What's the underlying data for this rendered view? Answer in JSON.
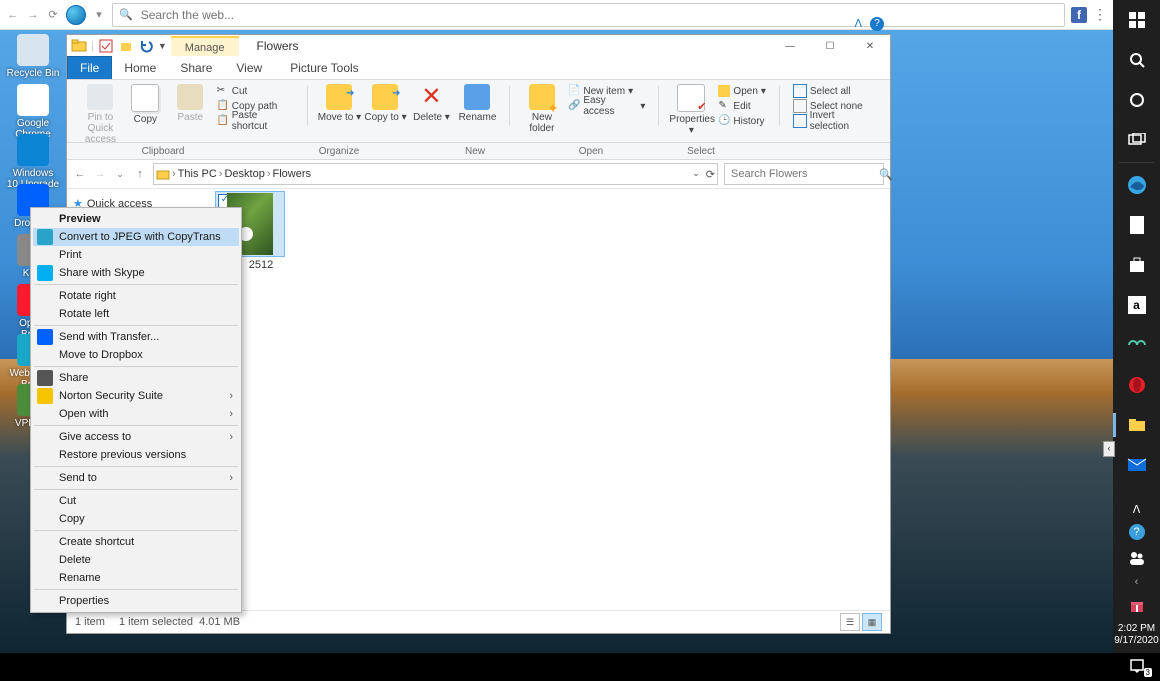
{
  "browser": {
    "search_placeholder": "Search the web..."
  },
  "desktop_icons": [
    {
      "label": "Recycle Bin"
    },
    {
      "label": "Google Chrome"
    },
    {
      "label": "Windows 10 Upgrade A..."
    },
    {
      "label": "Dropbox"
    },
    {
      "label": "Ke..."
    },
    {
      "label": "Opera Bro..."
    },
    {
      "label": "WebStorm Bro..."
    },
    {
      "label": "VPKie..."
    }
  ],
  "explorer": {
    "qat_manage": "Manage",
    "title": "Flowers",
    "tabs": {
      "file": "File",
      "home": "Home",
      "share": "Share",
      "view": "View",
      "picture_tools": "Picture Tools"
    },
    "ribbon": {
      "pin": "Pin to Quick access",
      "copy": "Copy",
      "paste": "Paste",
      "cut": "Cut",
      "copy_path": "Copy path",
      "paste_shortcut": "Paste shortcut",
      "move_to": "Move to",
      "copy_to": "Copy to",
      "delete": "Delete",
      "rename": "Rename",
      "new_folder": "New folder",
      "new_item": "New item",
      "easy_access": "Easy access",
      "properties": "Properties",
      "open": "Open",
      "edit": "Edit",
      "history": "History",
      "select_all": "Select all",
      "select_none": "Select none",
      "invert_selection": "Invert selection",
      "groups": {
        "clipboard": "Clipboard",
        "organize": "Organize",
        "new": "New",
        "open": "Open",
        "select": "Select"
      }
    },
    "breadcrumb": {
      "this_pc": "This PC",
      "desktop": "Desktop",
      "flowers": "Flowers"
    },
    "search_placeholder": "Search Flowers",
    "nav": {
      "quick_access": "Quick access"
    },
    "file": {
      "name_tail": "2512"
    },
    "status": {
      "count": "1 item",
      "selected": "1 item selected",
      "size": "4.01 MB"
    }
  },
  "context_menu": {
    "items": [
      {
        "label": "Preview",
        "bold": true
      },
      {
        "label": "Convert to JPEG with CopyTrans",
        "hover": true,
        "icon": "#2aa3c9"
      },
      {
        "label": "Print"
      },
      {
        "label": "Share with Skype",
        "icon": "#00aff0"
      },
      {
        "sep": true
      },
      {
        "label": "Rotate right"
      },
      {
        "label": "Rotate left"
      },
      {
        "sep": true
      },
      {
        "label": "Send with Transfer...",
        "icon": "#0061fe"
      },
      {
        "label": "Move to Dropbox"
      },
      {
        "sep": true
      },
      {
        "label": "Share",
        "icon": "#555"
      },
      {
        "label": "Norton Security Suite",
        "icon": "#f6c400",
        "sub": true
      },
      {
        "label": "Open with",
        "sub": true
      },
      {
        "sep": true
      },
      {
        "label": "Give access to",
        "sub": true
      },
      {
        "label": "Restore previous versions"
      },
      {
        "sep": true
      },
      {
        "label": "Send to",
        "sub": true
      },
      {
        "sep": true
      },
      {
        "label": "Cut"
      },
      {
        "label": "Copy"
      },
      {
        "sep": true
      },
      {
        "label": "Create shortcut"
      },
      {
        "label": "Delete"
      },
      {
        "label": "Rename"
      },
      {
        "sep": true
      },
      {
        "label": "Properties"
      }
    ]
  },
  "sidebar": {
    "time": "2:02 PM",
    "date": "9/17/2020"
  }
}
